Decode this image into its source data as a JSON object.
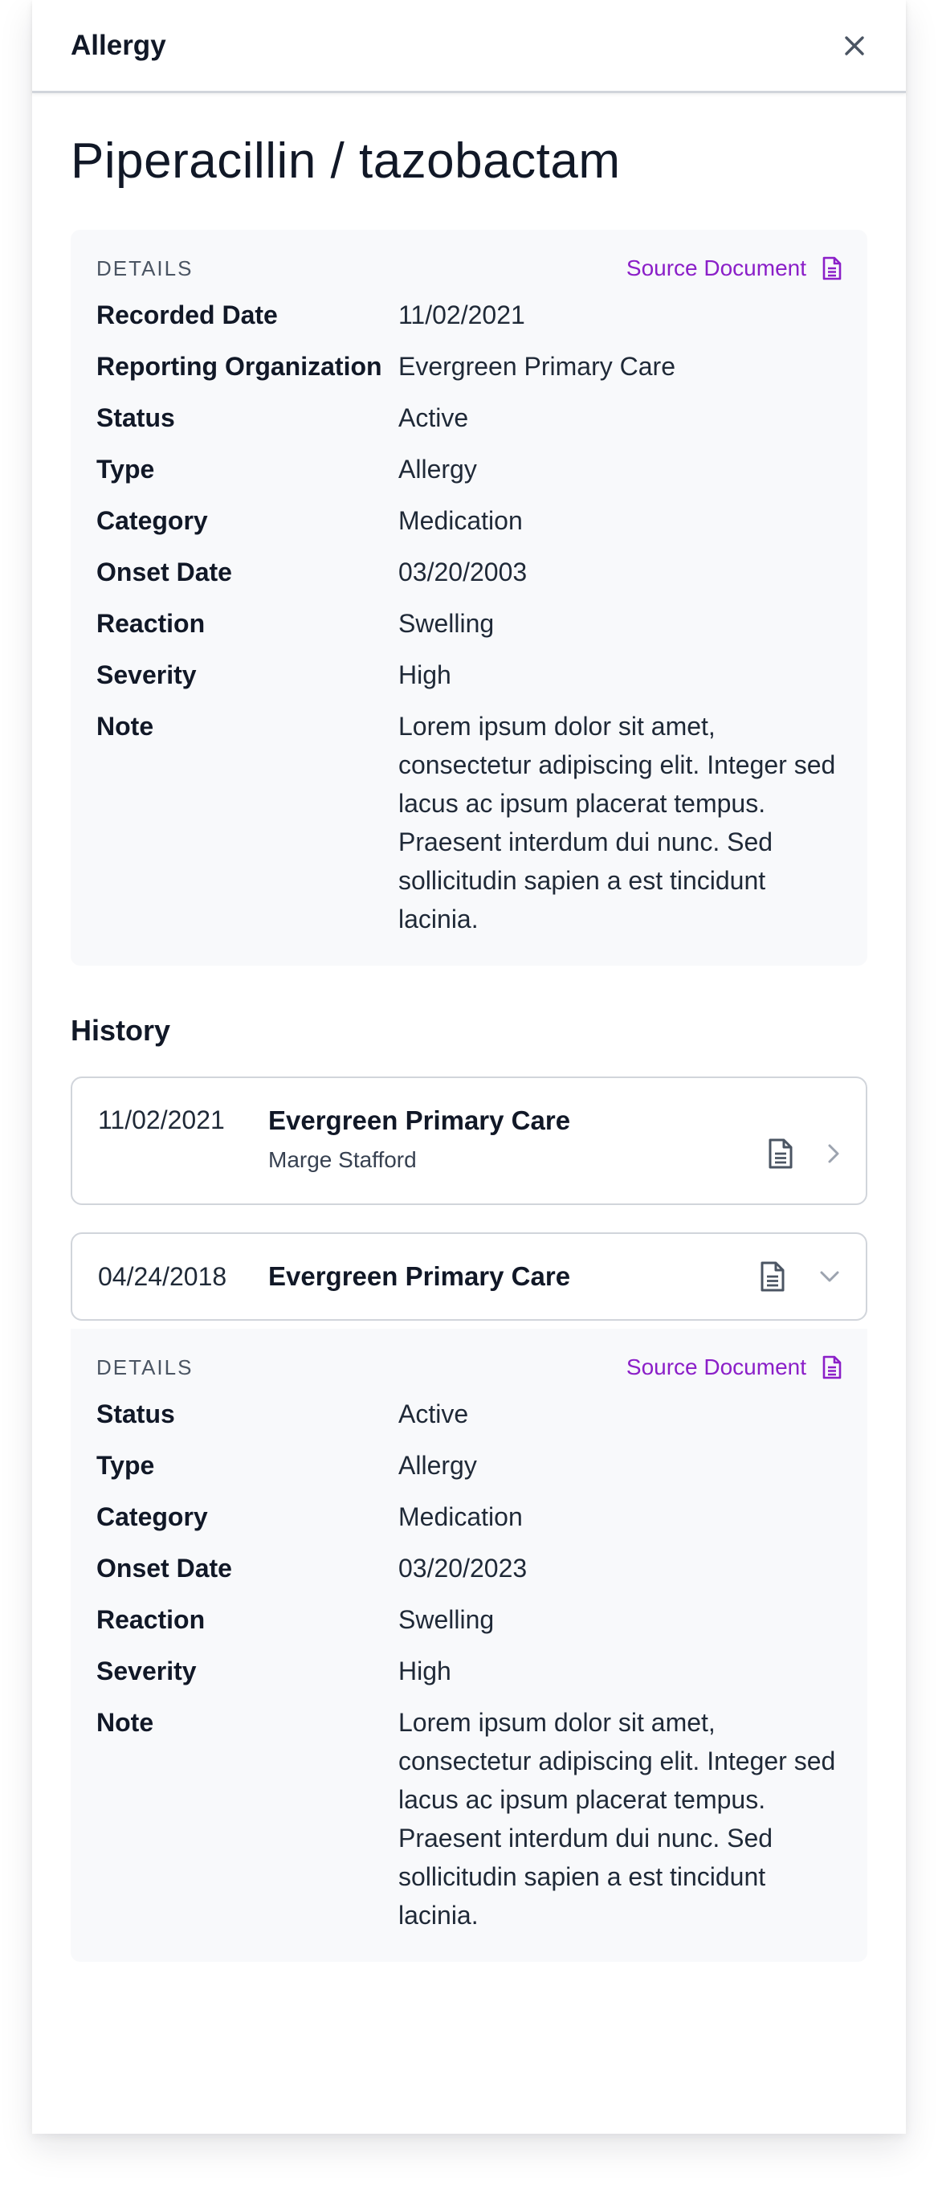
{
  "header": {
    "title": "Allergy"
  },
  "page_title": "Piperacillin / tazobactam",
  "details": {
    "label": "DETAILS",
    "source_label": "Source Document",
    "rows": [
      {
        "key": "Recorded Date",
        "value": "11/02/2021"
      },
      {
        "key": "Reporting Organization",
        "value": "Evergreen Primary Care"
      },
      {
        "key": "Status",
        "value": "Active"
      },
      {
        "key": "Type",
        "value": "Allergy"
      },
      {
        "key": "Category",
        "value": "Medication"
      },
      {
        "key": "Onset Date",
        "value": "03/20/2003"
      },
      {
        "key": "Reaction",
        "value": "Swelling"
      },
      {
        "key": "Severity",
        "value": "High"
      },
      {
        "key": "Note",
        "value": "Lorem ipsum dolor sit amet, consectetur adipiscing elit. Integer sed lacus ac ipsum placerat tempus. Praesent interdum dui nunc. Sed sollicitudin sapien a est tincidunt lacinia."
      }
    ]
  },
  "history": {
    "title": "History",
    "items": [
      {
        "date": "11/02/2021",
        "org": "Evergreen Primary Care",
        "person": "Marge Stafford",
        "expanded": false
      },
      {
        "date": "04/24/2018",
        "org": "Evergreen Primary Care",
        "expanded": true
      }
    ],
    "expanded_details": {
      "label": "DETAILS",
      "source_label": "Source Document",
      "rows": [
        {
          "key": "Status",
          "value": "Active"
        },
        {
          "key": "Type",
          "value": "Allergy"
        },
        {
          "key": "Category",
          "value": "Medication"
        },
        {
          "key": "Onset Date",
          "value": "03/20/2023"
        },
        {
          "key": "Reaction",
          "value": "Swelling"
        },
        {
          "key": "Severity",
          "value": "High"
        },
        {
          "key": "Note",
          "value": "Lorem ipsum dolor sit amet, consectetur adipiscing elit. Integer sed lacus ac ipsum placerat tempus. Praesent interdum dui nunc. Sed sollicitudin sapien a est tincidunt lacinia."
        }
      ]
    }
  },
  "colors": {
    "accent": "#8b1fc8",
    "card_bg": "#f8f9fb",
    "border": "#d1d5db"
  }
}
